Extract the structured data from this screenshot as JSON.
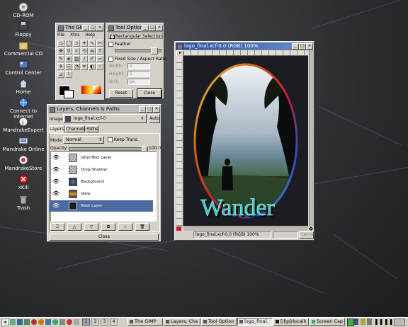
{
  "desktop": {
    "icons": [
      {
        "label": "CD-ROM",
        "icon": "cdrom-icon"
      },
      {
        "label": "Floppy",
        "icon": "floppy-icon"
      },
      {
        "label": "Commercial CD",
        "icon": "cd-icon"
      },
      {
        "label": "Control Center",
        "icon": "control-center-icon"
      },
      {
        "label": "Home",
        "icon": "home-icon"
      },
      {
        "label": "Connect to Internet",
        "icon": "internet-icon"
      },
      {
        "label": "MandrakeExpert",
        "icon": "expert-icon"
      },
      {
        "label": "Mandrake Online",
        "icon": "online-icon"
      },
      {
        "label": "MandrakeStore",
        "icon": "store-icon"
      },
      {
        "label": "xKill",
        "icon": "xkill-icon"
      },
      {
        "label": "Trash",
        "icon": "trash-icon"
      }
    ]
  },
  "gimp": {
    "title": "The GIMP",
    "menu": [
      "File",
      "Xtns",
      "Help"
    ]
  },
  "tool_options": {
    "title": "Tool Options",
    "heading": "Rectangular Selection",
    "feather_label": "Feather",
    "fixed_label": "Fixed Size / Aspect Ratio",
    "width_label": "Width:",
    "height_label": "Height:",
    "unit_label": "Unit:",
    "width_value": "1",
    "height_value": "1",
    "unit_value": "px",
    "reset_label": "Reset",
    "close_label": "Close"
  },
  "layers": {
    "title": "Layers, Channels & Paths",
    "image_label": "Image:",
    "image_value": "logo_final.xcf-0",
    "auto_label": "Auto",
    "tabs": [
      "Layers",
      "Channels",
      "Paths"
    ],
    "mode_label": "Mode:",
    "mode_value": "Normal",
    "keep_trans_label": "Keep Trans.",
    "opacity_label": "Opacity:",
    "opacity_value": "100.0",
    "items": [
      {
        "name": "GDynText Layer",
        "selected": false
      },
      {
        "name": "Drop-Shadow",
        "selected": false
      },
      {
        "name": "Background",
        "selected": false
      },
      {
        "name": "Glow",
        "selected": false
      },
      {
        "name": "Base Layer",
        "selected": true
      }
    ],
    "close_label": "Close"
  },
  "image_window": {
    "title": "logo_final.xcf-0.0 (RGB) 100%",
    "status_text": "logo_final.xcf-0.0 (RGB) 100%",
    "cancel_label": "Cancel",
    "art_text": "Wander"
  },
  "taskbar": {
    "workspaces": [
      "1",
      "2",
      "3",
      "4"
    ],
    "tasks": [
      {
        "label": "The GIMP",
        "active": false
      },
      {
        "label": "Layers, Cha",
        "active": false
      },
      {
        "label": "Tool Option",
        "active": false
      },
      {
        "label": "logo_final.",
        "active": true
      },
      {
        "label": "[jfg@localh",
        "active": false
      },
      {
        "label": "Screen Cap",
        "active": false
      }
    ]
  },
  "colors": {
    "selection": "#4a6aa0",
    "titlebar_active": "#2a4f9c",
    "art_text": "#43c8c4"
  }
}
